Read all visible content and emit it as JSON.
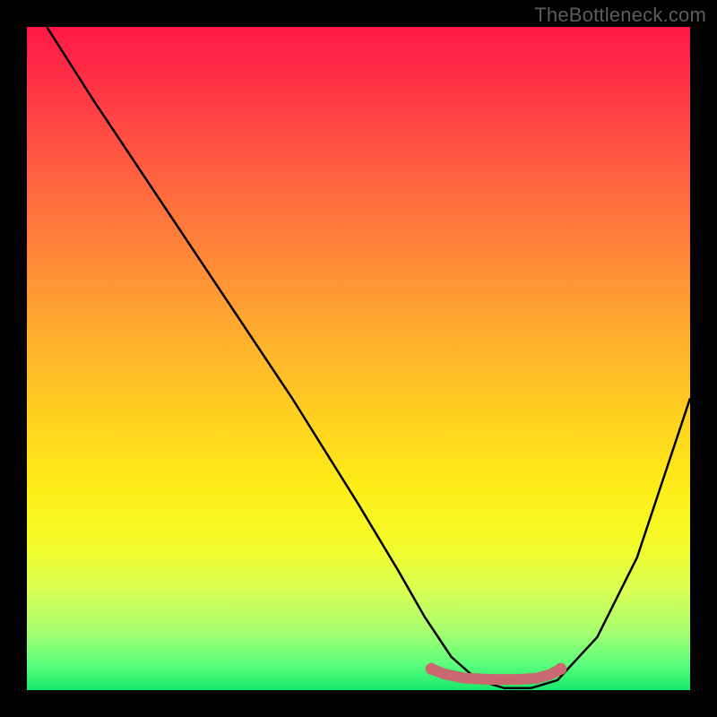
{
  "watermark": {
    "text": "TheBottleneck.com"
  },
  "chart_data": {
    "type": "line",
    "title": "",
    "xlabel": "",
    "ylabel": "",
    "xlim": [
      0,
      100
    ],
    "ylim": [
      0,
      100
    ],
    "grid": false,
    "legend": false,
    "series": [
      {
        "name": "bottleneck-curve",
        "color": "#000000",
        "x": [
          3,
          10,
          20,
          30,
          40,
          50,
          56,
          60,
          64,
          68,
          72,
          76,
          80,
          86,
          92,
          100
        ],
        "y": [
          100,
          89,
          74,
          59,
          44,
          28,
          18,
          11,
          5,
          1.5,
          0.3,
          0.3,
          1.5,
          8,
          20,
          44
        ]
      },
      {
        "name": "optimal-range-marker",
        "color": "#c96870",
        "x": [
          61,
          63,
          66,
          70,
          74,
          77,
          79,
          80.5
        ],
        "y": [
          3.2,
          2.4,
          1.8,
          1.6,
          1.6,
          1.8,
          2.4,
          3.2
        ]
      }
    ],
    "annotations": []
  },
  "colors": {
    "frame": "#000000",
    "curve": "#000000",
    "marker": "#c96870",
    "watermark": "#5c5c5c"
  }
}
